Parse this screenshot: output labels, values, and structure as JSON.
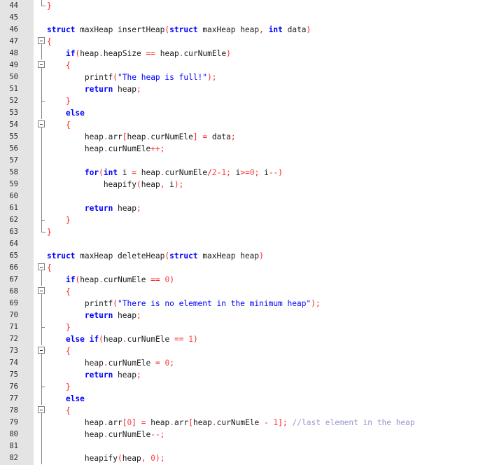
{
  "editor": {
    "lines": [
      {
        "n": "44",
        "fold": "corner",
        "t": [
          [
            "p",
            "}"
          ]
        ]
      },
      {
        "n": "45",
        "fold": "",
        "t": []
      },
      {
        "n": "46",
        "fold": "",
        "t": [
          [
            "k",
            "struct"
          ],
          [
            "x",
            " maxHeap insertHeap"
          ],
          [
            "p",
            "("
          ],
          [
            "k",
            "struct"
          ],
          [
            "x",
            " maxHeap heap"
          ],
          [
            "o",
            ","
          ],
          [
            "x",
            " "
          ],
          [
            "k",
            "int"
          ],
          [
            "x",
            " data"
          ],
          [
            "p",
            ")"
          ]
        ]
      },
      {
        "n": "47",
        "fold": "open",
        "t": [
          [
            "p",
            "{"
          ]
        ]
      },
      {
        "n": "48",
        "fold": "line",
        "t": [
          [
            "x",
            "    "
          ],
          [
            "k",
            "if"
          ],
          [
            "p",
            "("
          ],
          [
            "x",
            "heap"
          ],
          [
            "o",
            "."
          ],
          [
            "x",
            "heapSize "
          ],
          [
            "o",
            "=="
          ],
          [
            "x",
            " heap"
          ],
          [
            "o",
            "."
          ],
          [
            "x",
            "curNumEle"
          ],
          [
            "p",
            ")"
          ]
        ]
      },
      {
        "n": "49",
        "fold": "open",
        "t": [
          [
            "x",
            "    "
          ],
          [
            "p",
            "{"
          ]
        ]
      },
      {
        "n": "50",
        "fold": "line",
        "t": [
          [
            "x",
            "        printf"
          ],
          [
            "p",
            "("
          ],
          [
            "s",
            "\"The heap is full!\""
          ],
          [
            "p",
            ")"
          ],
          [
            "o",
            ";"
          ]
        ]
      },
      {
        "n": "51",
        "fold": "line",
        "t": [
          [
            "x",
            "        "
          ],
          [
            "k",
            "return"
          ],
          [
            "x",
            " heap"
          ],
          [
            "o",
            ";"
          ]
        ]
      },
      {
        "n": "52",
        "fold": "tick",
        "t": [
          [
            "x",
            "    "
          ],
          [
            "p",
            "}"
          ]
        ]
      },
      {
        "n": "53",
        "fold": "line",
        "t": [
          [
            "x",
            "    "
          ],
          [
            "k",
            "else"
          ]
        ]
      },
      {
        "n": "54",
        "fold": "open",
        "t": [
          [
            "x",
            "    "
          ],
          [
            "p",
            "{"
          ]
        ]
      },
      {
        "n": "55",
        "fold": "line",
        "t": [
          [
            "x",
            "        heap"
          ],
          [
            "o",
            "."
          ],
          [
            "x",
            "arr"
          ],
          [
            "p",
            "["
          ],
          [
            "x",
            "heap"
          ],
          [
            "o",
            "."
          ],
          [
            "x",
            "curNumEle"
          ],
          [
            "p",
            "]"
          ],
          [
            "x",
            " "
          ],
          [
            "o",
            "="
          ],
          [
            "x",
            " data"
          ],
          [
            "o",
            ";"
          ]
        ]
      },
      {
        "n": "56",
        "fold": "line",
        "t": [
          [
            "x",
            "        heap"
          ],
          [
            "o",
            "."
          ],
          [
            "x",
            "curNumEle"
          ],
          [
            "o",
            "++;"
          ]
        ]
      },
      {
        "n": "57",
        "fold": "line",
        "t": []
      },
      {
        "n": "58",
        "fold": "line",
        "t": [
          [
            "x",
            "        "
          ],
          [
            "k",
            "for"
          ],
          [
            "p",
            "("
          ],
          [
            "k",
            "int"
          ],
          [
            "x",
            " i "
          ],
          [
            "o",
            "="
          ],
          [
            "x",
            " heap"
          ],
          [
            "o",
            "."
          ],
          [
            "x",
            "curNumEle"
          ],
          [
            "o",
            "/"
          ],
          [
            "n",
            "2"
          ],
          [
            "o",
            "-"
          ],
          [
            "n",
            "1"
          ],
          [
            "o",
            ";"
          ],
          [
            "x",
            " i"
          ],
          [
            "o",
            ">="
          ],
          [
            "n",
            "0"
          ],
          [
            "o",
            ";"
          ],
          [
            "x",
            " i"
          ],
          [
            "o",
            "--"
          ],
          [
            "p",
            ")"
          ]
        ]
      },
      {
        "n": "59",
        "fold": "line",
        "t": [
          [
            "x",
            "            heapify"
          ],
          [
            "p",
            "("
          ],
          [
            "x",
            "heap"
          ],
          [
            "o",
            ","
          ],
          [
            "x",
            " i"
          ],
          [
            "p",
            ")"
          ],
          [
            "o",
            ";"
          ]
        ]
      },
      {
        "n": "60",
        "fold": "line",
        "t": []
      },
      {
        "n": "61",
        "fold": "line",
        "t": [
          [
            "x",
            "        "
          ],
          [
            "k",
            "return"
          ],
          [
            "x",
            " heap"
          ],
          [
            "o",
            ";"
          ]
        ]
      },
      {
        "n": "62",
        "fold": "tick",
        "t": [
          [
            "x",
            "    "
          ],
          [
            "p",
            "}"
          ]
        ]
      },
      {
        "n": "63",
        "fold": "corner",
        "t": [
          [
            "p",
            "}"
          ]
        ]
      },
      {
        "n": "64",
        "fold": "",
        "t": []
      },
      {
        "n": "65",
        "fold": "",
        "t": [
          [
            "k",
            "struct"
          ],
          [
            "x",
            " maxHeap deleteHeap"
          ],
          [
            "p",
            "("
          ],
          [
            "k",
            "struct"
          ],
          [
            "x",
            " maxHeap heap"
          ],
          [
            "p",
            ")"
          ]
        ]
      },
      {
        "n": "66",
        "fold": "open",
        "t": [
          [
            "p",
            "{"
          ]
        ]
      },
      {
        "n": "67",
        "fold": "line",
        "t": [
          [
            "x",
            "    "
          ],
          [
            "k",
            "if"
          ],
          [
            "p",
            "("
          ],
          [
            "x",
            "heap"
          ],
          [
            "o",
            "."
          ],
          [
            "x",
            "curNumEle "
          ],
          [
            "o",
            "=="
          ],
          [
            "x",
            " "
          ],
          [
            "n",
            "0"
          ],
          [
            "p",
            ")"
          ]
        ]
      },
      {
        "n": "68",
        "fold": "open",
        "t": [
          [
            "x",
            "    "
          ],
          [
            "p",
            "{"
          ]
        ]
      },
      {
        "n": "69",
        "fold": "line",
        "t": [
          [
            "x",
            "        printf"
          ],
          [
            "p",
            "("
          ],
          [
            "s",
            "\"There is no element in the minimum heap\""
          ],
          [
            "p",
            ")"
          ],
          [
            "o",
            ";"
          ]
        ]
      },
      {
        "n": "70",
        "fold": "line",
        "t": [
          [
            "x",
            "        "
          ],
          [
            "k",
            "return"
          ],
          [
            "x",
            " heap"
          ],
          [
            "o",
            ";"
          ]
        ]
      },
      {
        "n": "71",
        "fold": "tick",
        "t": [
          [
            "x",
            "    "
          ],
          [
            "p",
            "}"
          ]
        ]
      },
      {
        "n": "72",
        "fold": "line",
        "t": [
          [
            "x",
            "    "
          ],
          [
            "k",
            "else"
          ],
          [
            "x",
            " "
          ],
          [
            "k",
            "if"
          ],
          [
            "p",
            "("
          ],
          [
            "x",
            "heap"
          ],
          [
            "o",
            "."
          ],
          [
            "x",
            "curNumEle "
          ],
          [
            "o",
            "=="
          ],
          [
            "x",
            " "
          ],
          [
            "n",
            "1"
          ],
          [
            "p",
            ")"
          ]
        ]
      },
      {
        "n": "73",
        "fold": "open",
        "t": [
          [
            "x",
            "    "
          ],
          [
            "p",
            "{"
          ]
        ]
      },
      {
        "n": "74",
        "fold": "line",
        "t": [
          [
            "x",
            "        heap"
          ],
          [
            "o",
            "."
          ],
          [
            "x",
            "curNumEle "
          ],
          [
            "o",
            "="
          ],
          [
            "x",
            " "
          ],
          [
            "n",
            "0"
          ],
          [
            "o",
            ";"
          ]
        ]
      },
      {
        "n": "75",
        "fold": "line",
        "t": [
          [
            "x",
            "        "
          ],
          [
            "k",
            "return"
          ],
          [
            "x",
            " heap"
          ],
          [
            "o",
            ";"
          ]
        ]
      },
      {
        "n": "76",
        "fold": "tick",
        "t": [
          [
            "x",
            "    "
          ],
          [
            "p",
            "}"
          ]
        ]
      },
      {
        "n": "77",
        "fold": "line",
        "t": [
          [
            "x",
            "    "
          ],
          [
            "k",
            "else"
          ]
        ]
      },
      {
        "n": "78",
        "fold": "open",
        "t": [
          [
            "x",
            "    "
          ],
          [
            "p",
            "{"
          ]
        ]
      },
      {
        "n": "79",
        "fold": "line",
        "t": [
          [
            "x",
            "        heap"
          ],
          [
            "o",
            "."
          ],
          [
            "x",
            "arr"
          ],
          [
            "p",
            "["
          ],
          [
            "n",
            "0"
          ],
          [
            "p",
            "]"
          ],
          [
            "x",
            " "
          ],
          [
            "o",
            "="
          ],
          [
            "x",
            " heap"
          ],
          [
            "o",
            "."
          ],
          [
            "x",
            "arr"
          ],
          [
            "p",
            "["
          ],
          [
            "x",
            "heap"
          ],
          [
            "o",
            "."
          ],
          [
            "x",
            "curNumEle "
          ],
          [
            "o",
            "-"
          ],
          [
            "x",
            " "
          ],
          [
            "n",
            "1"
          ],
          [
            "p",
            "]"
          ],
          [
            "o",
            ";"
          ],
          [
            "x",
            " "
          ],
          [
            "c",
            "//last element in the heap"
          ]
        ]
      },
      {
        "n": "80",
        "fold": "line",
        "t": [
          [
            "x",
            "        heap"
          ],
          [
            "o",
            "."
          ],
          [
            "x",
            "curNumEle"
          ],
          [
            "o",
            "--;"
          ]
        ]
      },
      {
        "n": "81",
        "fold": "line",
        "t": []
      },
      {
        "n": "82",
        "fold": "line",
        "t": [
          [
            "x",
            "        heapify"
          ],
          [
            "p",
            "("
          ],
          [
            "x",
            "heap"
          ],
          [
            "o",
            ","
          ],
          [
            "x",
            " "
          ],
          [
            "n",
            "0"
          ],
          [
            "p",
            ")"
          ],
          [
            "o",
            ";"
          ]
        ]
      }
    ]
  }
}
